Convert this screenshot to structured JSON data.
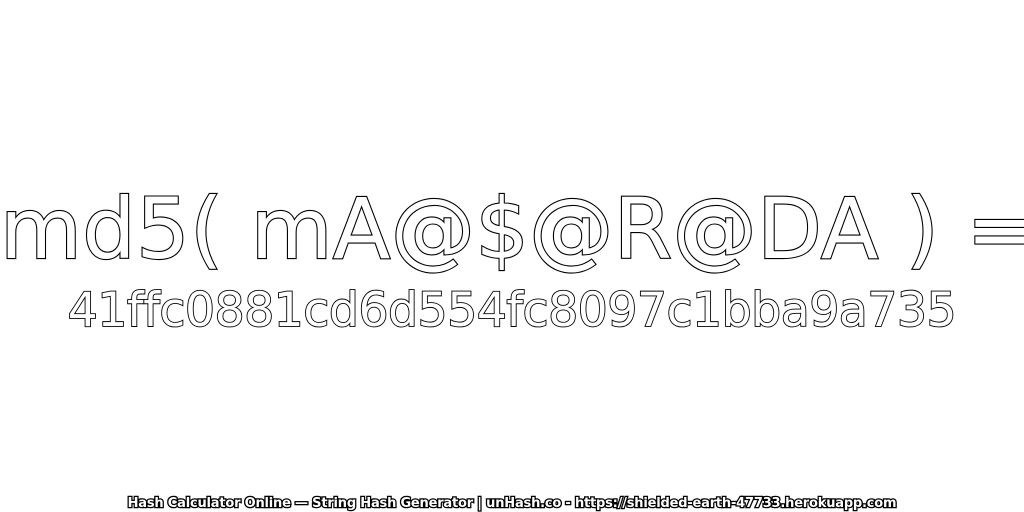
{
  "expression": "md5( mA@$@R@DA ) =",
  "hash": "41ffc0881cd6d554fc8097c1bba9a735",
  "footer": "Hash Calculator Online — String Hash Generator | unHash.co - https://shielded-earth-47733.herokuapp.com",
  "colors": {
    "background": "#ffffff",
    "text_fill": "#ffffff",
    "text_outline": "#000000"
  }
}
